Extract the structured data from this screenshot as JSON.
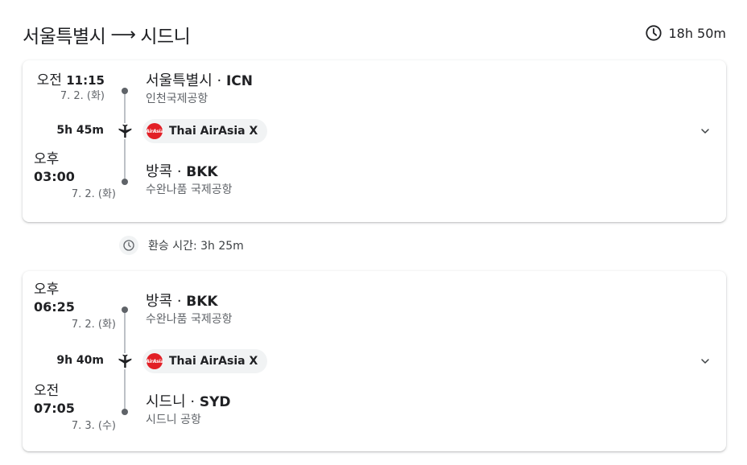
{
  "header": {
    "origin": "서울특별시",
    "arrow": "⟶",
    "destination": "시드니",
    "total_duration": "18h 50m"
  },
  "legs": [
    {
      "dep_ampm": "오전",
      "dep_time": "11:15",
      "dep_date": "7. 2. (화)",
      "dep_city": "서울특별시",
      "dep_code": "ICN",
      "dep_airport": "인천국제공항",
      "duration": "5h 45m",
      "airline": "Thai AirAsia X",
      "arr_ampm": "오후",
      "arr_time": "03:00",
      "arr_date": "7. 2. (화)",
      "arr_city": "방콕",
      "arr_code": "BKK",
      "arr_airport": "수완나품 국제공항"
    },
    {
      "dep_ampm": "오후",
      "dep_time": "06:25",
      "dep_date": "7. 2. (화)",
      "dep_city": "방콕",
      "dep_code": "BKK",
      "dep_airport": "수완나품 국제공항",
      "duration": "9h 40m",
      "airline": "Thai AirAsia X",
      "arr_ampm": "오전",
      "arr_time": "07:05",
      "arr_date": "7. 3. (수)",
      "arr_city": "시드니",
      "arr_code": "SYD",
      "arr_airport": "시드니 공항"
    }
  ],
  "layover": {
    "label": "환승 시간: 3h 25m"
  },
  "airline_logo_text": "AirAsia",
  "separator": " · ",
  "colors": {
    "logo_red": "#e21f26",
    "chip_bg": "#f1f3f4",
    "muted": "#5f6368"
  },
  "icons": {
    "duration": "clock-icon",
    "leg": "airplane-icon",
    "expand": "chevron-down-icon",
    "layover": "clock-icon"
  }
}
